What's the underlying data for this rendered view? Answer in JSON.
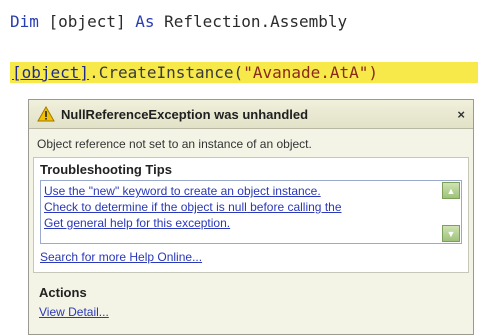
{
  "code": {
    "line1": {
      "kw1": "Dim ",
      "plain": "[object] ",
      "kw2": "As ",
      "type": "Reflection.Assembly"
    },
    "line2": {
      "obj": "[object]",
      "call": ".CreateInstance(",
      "str": "\"Avanade.AtA\")"
    }
  },
  "exception": {
    "title": "NullReferenceException was unhandled",
    "close_label": "×",
    "message": "Object reference not set to an instance of an object.",
    "tips_title": "Troubleshooting Tips",
    "tips": [
      "Use the \"new\" keyword to create an object instance.",
      "Check to determine if the object is null before calling the",
      "Get general help for this exception."
    ],
    "search_link": "Search for more Help Online...",
    "actions_title": "Actions",
    "view_detail_link": "View Detail..."
  },
  "colors": {
    "highlight": "#f7e94a",
    "link": "#2a39b8",
    "keyword": "#2a3db0",
    "scroll_button": "#9ec27a"
  },
  "icons": {
    "warning": "warning-triangle-icon",
    "scroll_up": "scroll-up-icon",
    "scroll_down": "scroll-down-icon"
  }
}
